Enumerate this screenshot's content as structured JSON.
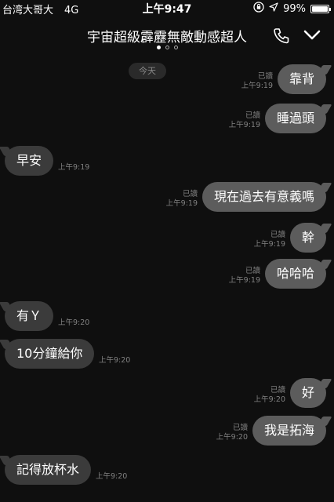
{
  "status_bar": {
    "carrier": "台湾大哥大",
    "network": "4G",
    "time": "上午9:47",
    "battery": "99%",
    "battery_level": 0.99
  },
  "header": {
    "title": "宇宙超級霹靂無敵動感超人",
    "page_dots": 3,
    "active_dot": 0
  },
  "date_separator": "今天",
  "messages": [
    {
      "dir": "out",
      "text": "靠背",
      "read": "已讀",
      "time": "上午9:19"
    },
    {
      "dir": "out",
      "text": "睡過頭",
      "read": "已讀",
      "time": "上午9:19"
    },
    {
      "dir": "in",
      "text": "早安",
      "time": "上午9:19"
    },
    {
      "dir": "out",
      "text": "現在過去有意義嗎",
      "read": "已讀",
      "time": "上午9:19"
    },
    {
      "dir": "out",
      "text": "幹",
      "read": "已讀",
      "time": "上午9:19"
    },
    {
      "dir": "out",
      "text": "哈哈哈",
      "read": "已讀",
      "time": "上午9:19"
    },
    {
      "dir": "in",
      "text": "有Ｙ",
      "time": "上午9:20"
    },
    {
      "dir": "in",
      "text": "10分鐘給你",
      "time": "上午9:20"
    },
    {
      "dir": "out",
      "text": "好",
      "read": "已讀",
      "time": "上午9:20"
    },
    {
      "dir": "out",
      "text": "我是拓海",
      "read": "已讀",
      "time": "上午9:20"
    },
    {
      "dir": "in",
      "text": "記得放杯水",
      "time": "上午9:20"
    }
  ],
  "icons": {
    "lock": "orientation-lock-icon",
    "location": "location-arrow-icon",
    "call": "phone-icon",
    "collapse": "chevron-down-icon"
  }
}
